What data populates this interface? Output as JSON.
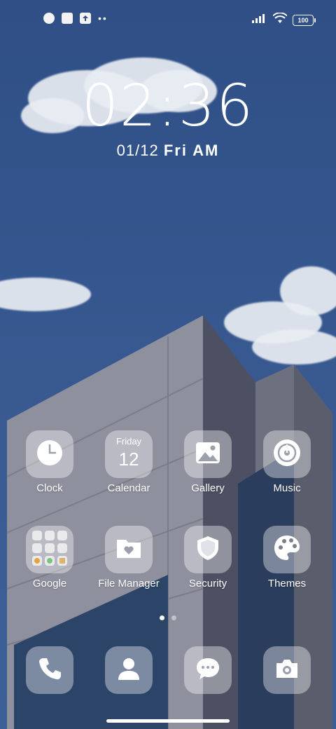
{
  "status_bar": {
    "left_icons": [
      "app-notification-icon",
      "square-notification-icon",
      "upload-icon"
    ],
    "more_indicator": "••",
    "battery": "100"
  },
  "lock": {
    "time": "02:36",
    "date": "01/12",
    "day": "Fri",
    "ampm": "AM"
  },
  "apps": [
    {
      "label": "Clock",
      "icon": "clock-icon"
    },
    {
      "label": "Calendar",
      "icon": "calendar-icon",
      "day": "Friday",
      "date": "12"
    },
    {
      "label": "Gallery",
      "icon": "gallery-icon"
    },
    {
      "label": "Music",
      "icon": "music-icon"
    },
    {
      "label": "Google",
      "icon": "google-folder-icon"
    },
    {
      "label": "File Manager",
      "icon": "file-manager-icon"
    },
    {
      "label": "Security",
      "icon": "security-shield-icon"
    },
    {
      "label": "Themes",
      "icon": "themes-palette-icon"
    }
  ],
  "dock": [
    {
      "icon": "phone-icon"
    },
    {
      "icon": "contacts-icon"
    },
    {
      "icon": "messages-icon"
    },
    {
      "icon": "camera-icon"
    }
  ],
  "page_indicator": {
    "pages": 2,
    "current": 1
  }
}
